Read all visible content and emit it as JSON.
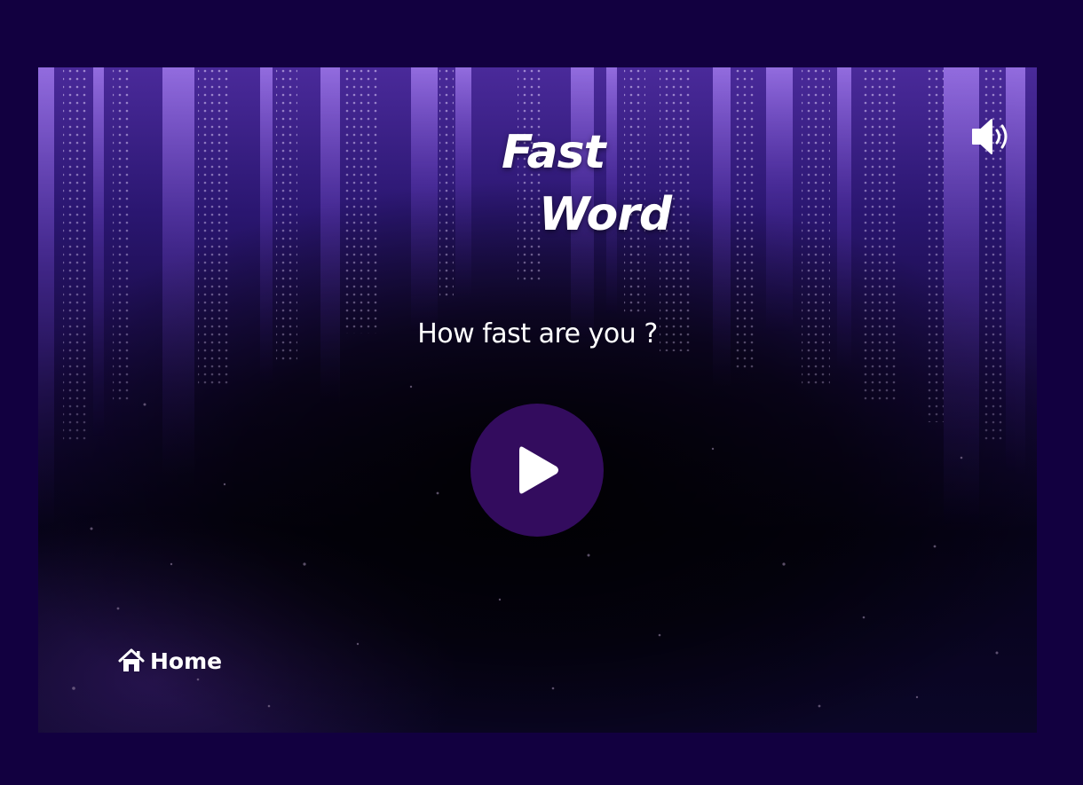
{
  "game": {
    "title_line1": "Fast",
    "title_line2": "Word",
    "tagline": "How fast are you ?"
  },
  "controls": {
    "play_icon": "play-icon",
    "sound_icon": "speaker-volume-icon",
    "home_icon": "home-icon",
    "home_label": "Home"
  },
  "colors": {
    "page_background": "#120040",
    "play_button": "#330c5e",
    "text": "#ffffff"
  }
}
